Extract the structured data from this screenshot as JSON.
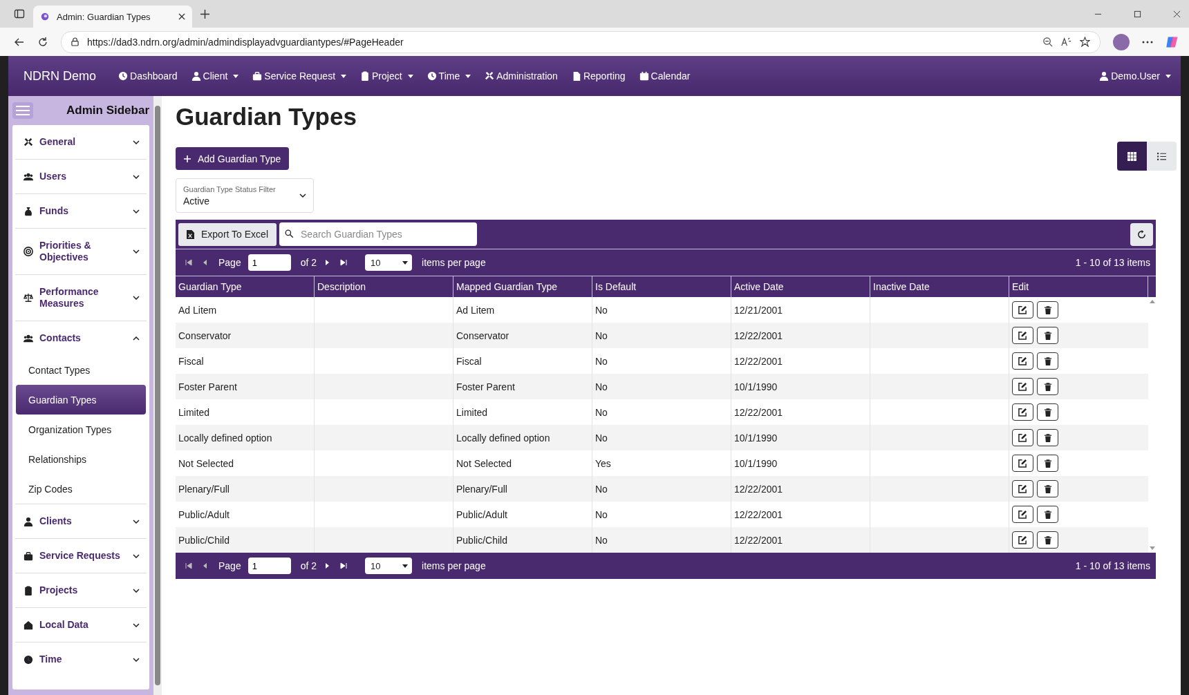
{
  "browser": {
    "tab_title": "Admin: Guardian Types",
    "url": "https://dad3.ndrn.org/admin/admindisplayadvguardiantypes/#PageHeader"
  },
  "navbar": {
    "brand": "NDRN Demo",
    "items": [
      {
        "label": "Dashboard",
        "dropdown": false
      },
      {
        "label": "Client",
        "dropdown": true
      },
      {
        "label": "Service Request",
        "dropdown": true
      },
      {
        "label": "Project",
        "dropdown": true
      },
      {
        "label": "Time",
        "dropdown": true
      },
      {
        "label": "Administration",
        "dropdown": false
      },
      {
        "label": "Reporting",
        "dropdown": false
      },
      {
        "label": "Calendar",
        "dropdown": false
      }
    ],
    "user": "Demo.User"
  },
  "sidebar": {
    "title": "Admin Sidebar",
    "sections": [
      {
        "label": "General",
        "expanded": false
      },
      {
        "label": "Users",
        "expanded": false
      },
      {
        "label": "Funds",
        "expanded": false
      },
      {
        "label": "Priorities & Objectives",
        "expanded": false
      },
      {
        "label": "Performance Measures",
        "expanded": false
      },
      {
        "label": "Contacts",
        "expanded": true,
        "children": [
          {
            "label": "Contact Types",
            "selected": false
          },
          {
            "label": "Guardian Types",
            "selected": true
          },
          {
            "label": "Organization Types",
            "selected": false
          },
          {
            "label": "Relationships",
            "selected": false
          },
          {
            "label": "Zip Codes",
            "selected": false
          }
        ]
      },
      {
        "label": "Clients",
        "expanded": false
      },
      {
        "label": "Service Requests",
        "expanded": false
      },
      {
        "label": "Projects",
        "expanded": false
      },
      {
        "label": "Local Data",
        "expanded": false
      },
      {
        "label": "Time",
        "expanded": false
      }
    ]
  },
  "page": {
    "title": "Guardian Types",
    "add_button": "Add Guardian Type",
    "view_toggle": [
      {
        "kind": "grid",
        "selected": true
      },
      {
        "kind": "list",
        "selected": false
      }
    ],
    "status_filter": {
      "label": "Guardian Type Status Filter",
      "value": "Active"
    }
  },
  "grid": {
    "export_button": "Export To Excel",
    "search": {
      "placeholder": "Search Guardian Types"
    },
    "pager_top": {
      "page_label": "Page",
      "page": "1",
      "of": "of 2",
      "per_page": "10",
      "per_page_label": "items per page",
      "summary": "1 - 10 of 13 items"
    },
    "columns": [
      "Guardian Type",
      "Description",
      "Mapped Guardian Type",
      "Is Default",
      "Active Date",
      "Inactive Date",
      "Edit"
    ],
    "rows": [
      [
        "Ad Litem",
        "",
        "Ad Litem",
        "No",
        "12/21/2001",
        ""
      ],
      [
        "Conservator",
        "",
        "Conservator",
        "No",
        "12/22/2001",
        ""
      ],
      [
        "Fiscal",
        "",
        "Fiscal",
        "No",
        "12/22/2001",
        ""
      ],
      [
        "Foster Parent",
        "",
        "Foster Parent",
        "No",
        "10/1/1990",
        ""
      ],
      [
        "Limited",
        "",
        "Limited",
        "No",
        "12/22/2001",
        ""
      ],
      [
        "Locally defined option",
        "",
        "Locally defined option",
        "No",
        "10/1/1990",
        ""
      ],
      [
        "Not Selected",
        "",
        "Not Selected",
        "Yes",
        "10/1/1990",
        ""
      ],
      [
        "Plenary/Full",
        "",
        "Plenary/Full",
        "No",
        "12/22/2001",
        ""
      ],
      [
        "Public/Adult",
        "",
        "Public/Adult",
        "No",
        "12/22/2001",
        ""
      ],
      [
        "Public/Child",
        "",
        "Public/Child",
        "No",
        "12/22/2001",
        ""
      ]
    ],
    "pager_bottom": {
      "page_label": "Page",
      "page": "1",
      "of": "of 2",
      "per_page": "10",
      "per_page_label": "items per page",
      "summary": "1 - 10 of 13 items"
    }
  }
}
